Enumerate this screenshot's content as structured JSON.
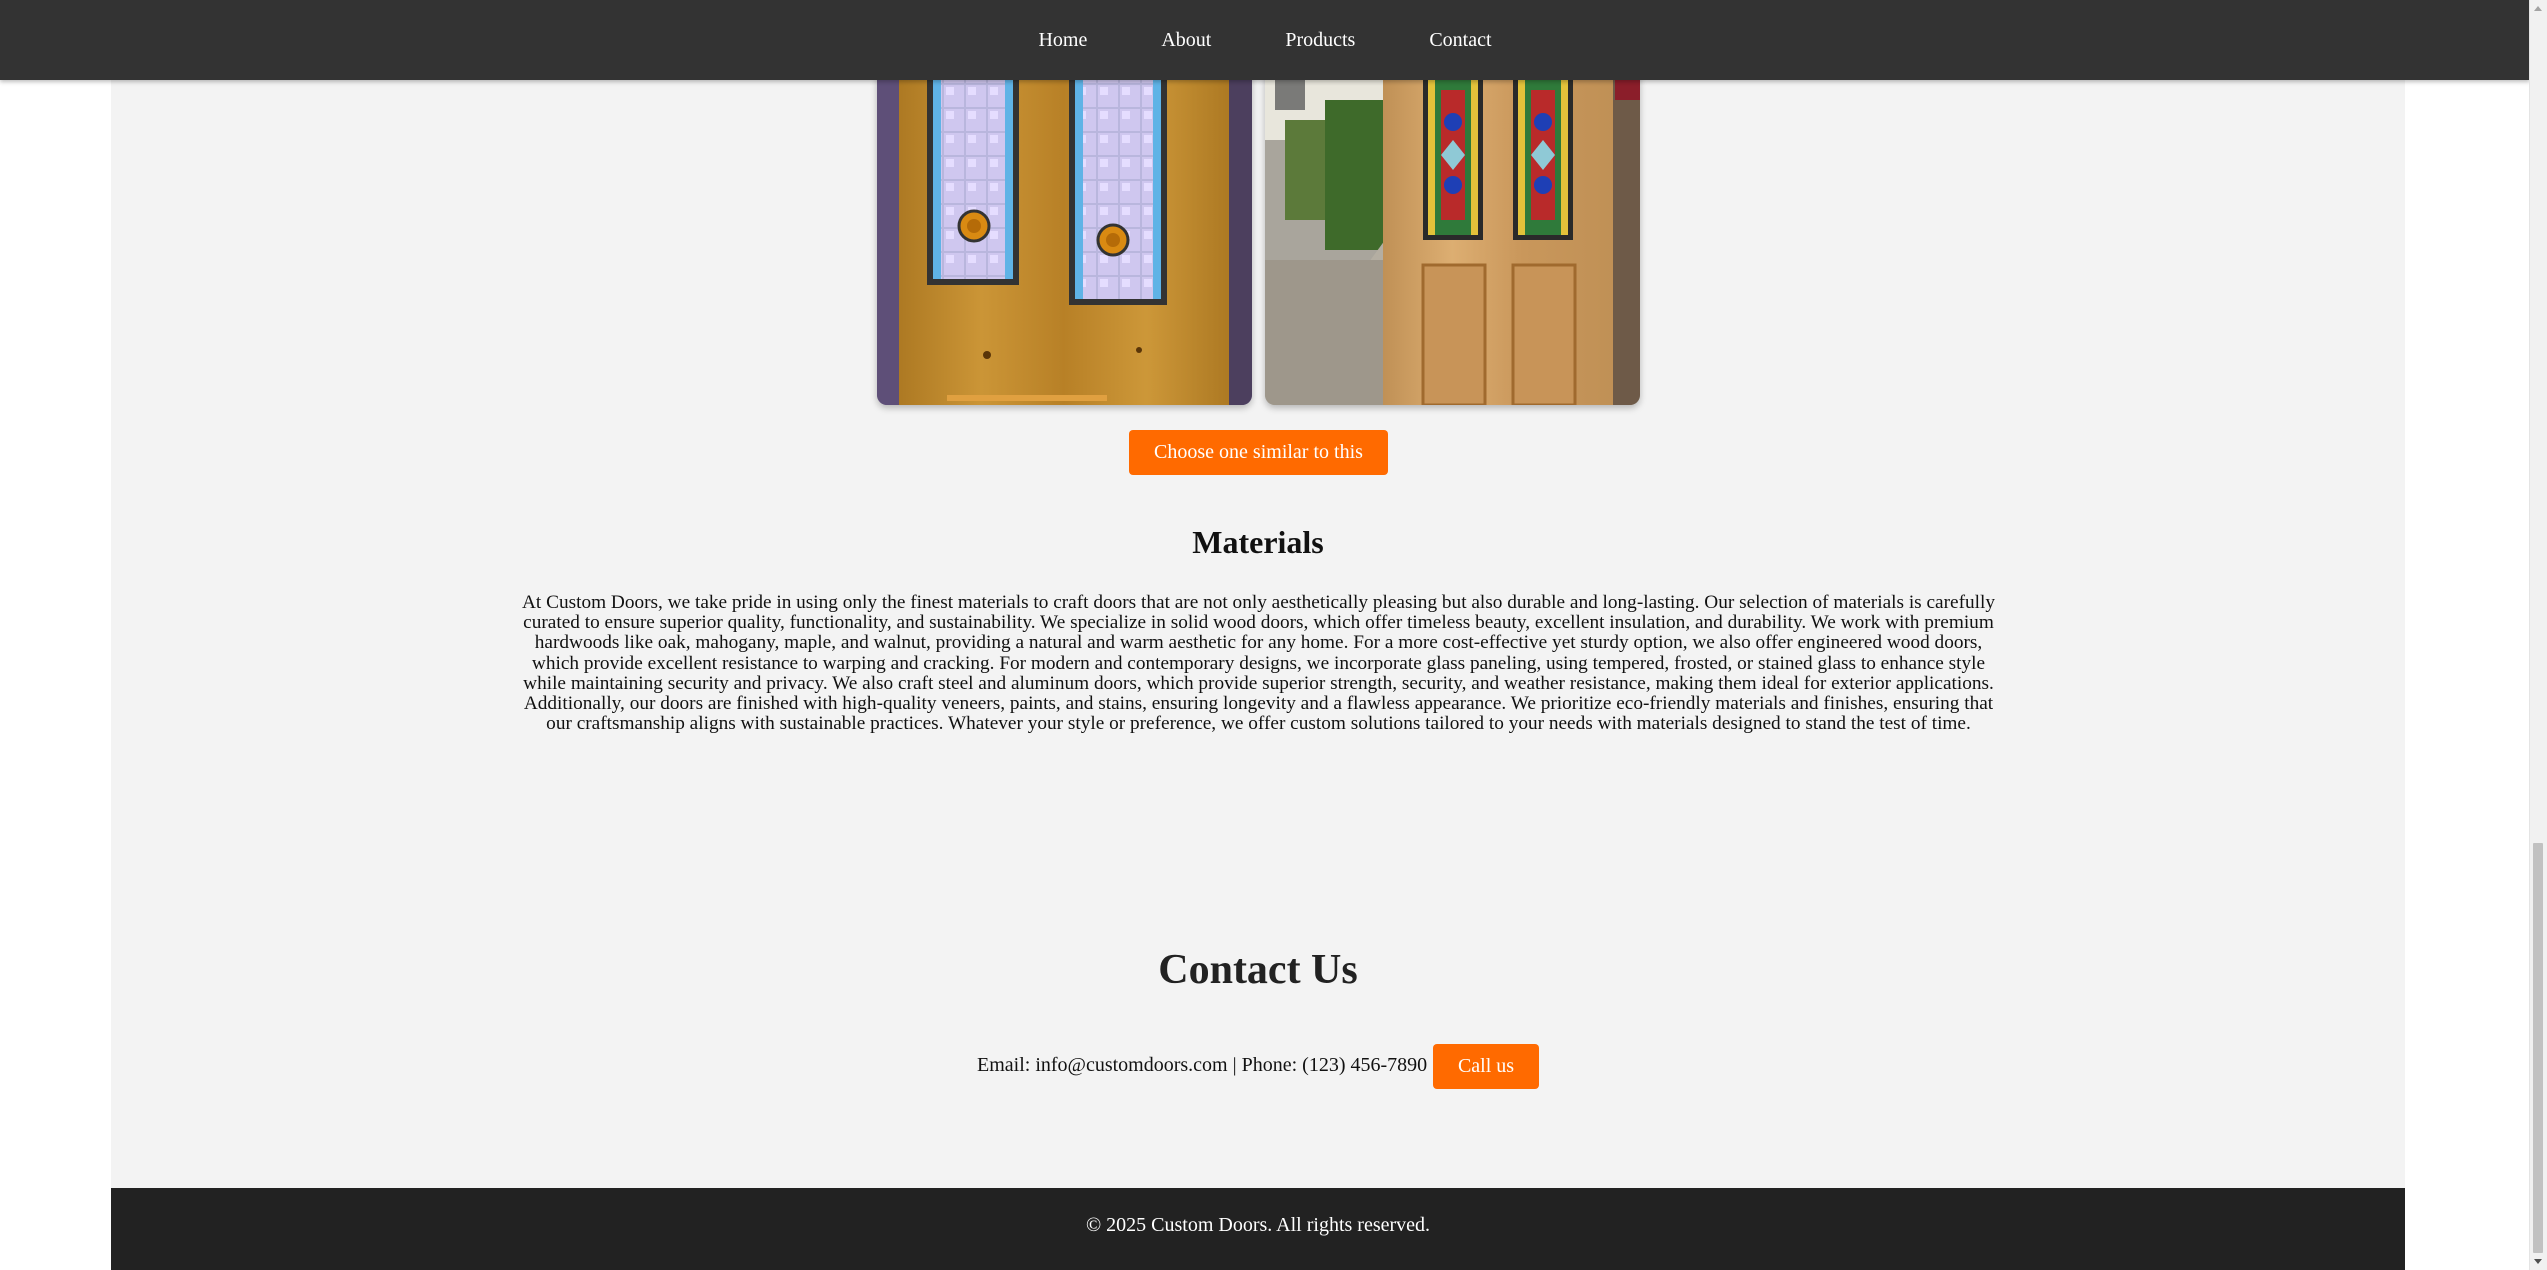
{
  "nav": {
    "items": [
      "Home",
      "About",
      "Products",
      "Contact"
    ]
  },
  "gallery": {
    "images": [
      {
        "icon": "stained-glass-door-photo",
        "description_visible": false
      },
      {
        "icon": "stained-glass-door-photo",
        "description_visible": false
      }
    ],
    "choose_button": "Choose one similar to this"
  },
  "materials": {
    "title": "Materials",
    "body": "At Custom Doors, we take pride in using only the finest materials to craft doors that are not only aesthetically pleasing but also durable and long-lasting. Our selection of materials is carefully curated to ensure superior quality, functionality, and sustainability. We specialize in solid wood doors, which offer timeless beauty, excellent insulation, and durability. We work with premium hardwoods like oak, mahogany, maple, and walnut, providing a natural and warm aesthetic for any home. For a more cost-effective yet sturdy option, we also offer engineered wood doors, which provide excellent resistance to warping and cracking. For modern and contemporary designs, we incorporate glass paneling, using tempered, frosted, or stained glass to enhance style while maintaining security and privacy. We also craft steel and aluminum doors, which provide superior strength, security, and weather resistance, making them ideal for exterior applications. Additionally, our doors are finished with high-quality veneers, paints, and stains, ensuring longevity and a flawless appearance. We prioritize eco-friendly materials and finishes, ensuring that our craftsmanship aligns with sustainable practices. Whatever your style or preference, we offer custom solutions tailored to your needs with materials designed to stand the test of time."
  },
  "contact": {
    "title": "Contact Us",
    "line": "Email: info@customdoors.com | Phone: (123) 456-7890",
    "call_button": "Call us"
  },
  "footer": {
    "text": "© 2025 Custom Doors. All rights reserved."
  },
  "colors": {
    "nav_bg": "#333333",
    "accent": "#ff6a00",
    "page_bg": "#f3f3f3",
    "footer_bg": "#222222"
  }
}
